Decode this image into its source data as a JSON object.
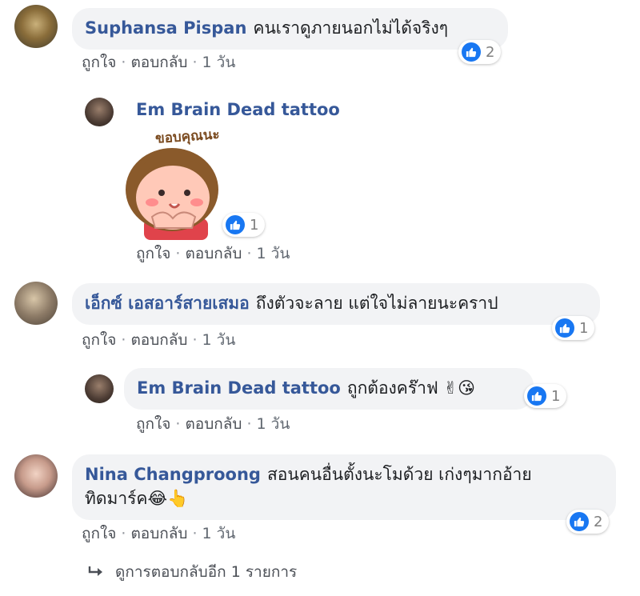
{
  "comments": [
    {
      "name": "Suphansa Pispan",
      "text": "คนเราดูภายนอกไม่ได้จริงๆ",
      "reactions": "2",
      "like": "ถูกใจ",
      "reply": "ตอบกลับ",
      "time": "1 วัน"
    },
    {
      "name": "เอ็กซ์ เอสอาร์สายเสมอ",
      "text": "ถึงตัวจะลาย แต่ใจไม่ลายนะคราป",
      "reactions": "1",
      "like": "ถูกใจ",
      "reply": "ตอบกลับ",
      "time": "1 วัน"
    },
    {
      "name": "Nina Changproong",
      "text_line1": "สอนคนอื่นตั้งนะโมด้วย เก่งๆมากอ้าย",
      "text_line2": "ทิดมาร์ค",
      "emoji": "😂👆",
      "reactions": "2",
      "like": "ถูกใจ",
      "reply": "ตอบกลับ",
      "time": "1 วัน"
    }
  ],
  "replies": [
    {
      "name": "Em Brain Dead tattoo",
      "sticker_text": "ขอบคุณนะ",
      "reactions": "1",
      "like": "ถูกใจ",
      "reply": "ตอบกลับ",
      "time": "1 วัน"
    },
    {
      "name": "Em Brain Dead tattoo",
      "text": "ถูกต้องคร๊าฟ",
      "emoji": "✌😘",
      "reactions": "1",
      "like": "ถูกใจ",
      "reply": "ตอบกลับ",
      "time": "1 วัน"
    }
  ],
  "more_replies": "ดูการตอบกลับอีก 1 รายการ",
  "icons": {
    "like": "like-thumb-icon",
    "reply_arrow": "reply-arrow-icon"
  },
  "colors": {
    "name": "#365899",
    "like_blue": "#1877f2",
    "bubble": "#f2f3f5"
  }
}
